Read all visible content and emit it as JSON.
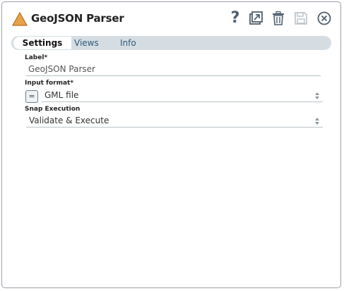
{
  "dialog": {
    "title": "GeoJSON Parser",
    "accent_color": "#e8a34a"
  },
  "header_icons": [
    "help-icon",
    "export-icon",
    "delete-icon",
    "save-icon",
    "close-icon"
  ],
  "help_glyph": "?",
  "tabs": [
    {
      "label": "Settings",
      "active": true
    },
    {
      "label": "Views",
      "active": false
    },
    {
      "label": "Info",
      "active": false
    }
  ],
  "fields": {
    "label": {
      "label": "Label*",
      "value": "GeoJSON Parser"
    },
    "input_format": {
      "label": "Input format*",
      "value": "GML file",
      "expr_glyph": "="
    },
    "snap_execution": {
      "label": "Snap Execution",
      "value": "Validate & Execute"
    }
  }
}
